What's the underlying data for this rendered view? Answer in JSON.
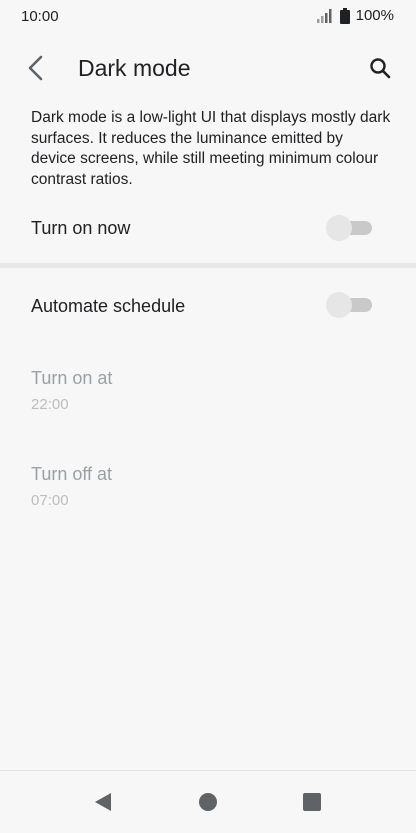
{
  "status_bar": {
    "time": "10:00",
    "battery": "100%",
    "icons": [
      "signal-icon",
      "battery-icon"
    ]
  },
  "app_bar": {
    "title": "Dark mode",
    "icons": [
      "back-arrow-icon",
      "search-icon"
    ]
  },
  "description": "Dark mode is a low-light UI that displays mostly dark surfaces. It reduces the luminance emitted by device screens, while still meeting minimum colour contrast ratios.",
  "turn_on_now": {
    "label": "Turn on now",
    "enabled": false
  },
  "automate_schedule": {
    "label": "Automate schedule",
    "enabled": false
  },
  "turn_on_at": {
    "label": "Turn on at",
    "value": "22:00"
  },
  "turn_off_at": {
    "label": "Turn off at",
    "value": "07:00"
  },
  "nav_bar": {
    "icons": [
      "back-triangle-icon",
      "home-circle-icon",
      "recents-square-icon"
    ]
  },
  "colors": {
    "background": "#f7f7f7",
    "text": "#202124",
    "disabled_text": "#9aa0a6",
    "switch_track": "#c9c9c9",
    "switch_thumb": "#e6e6e6"
  }
}
